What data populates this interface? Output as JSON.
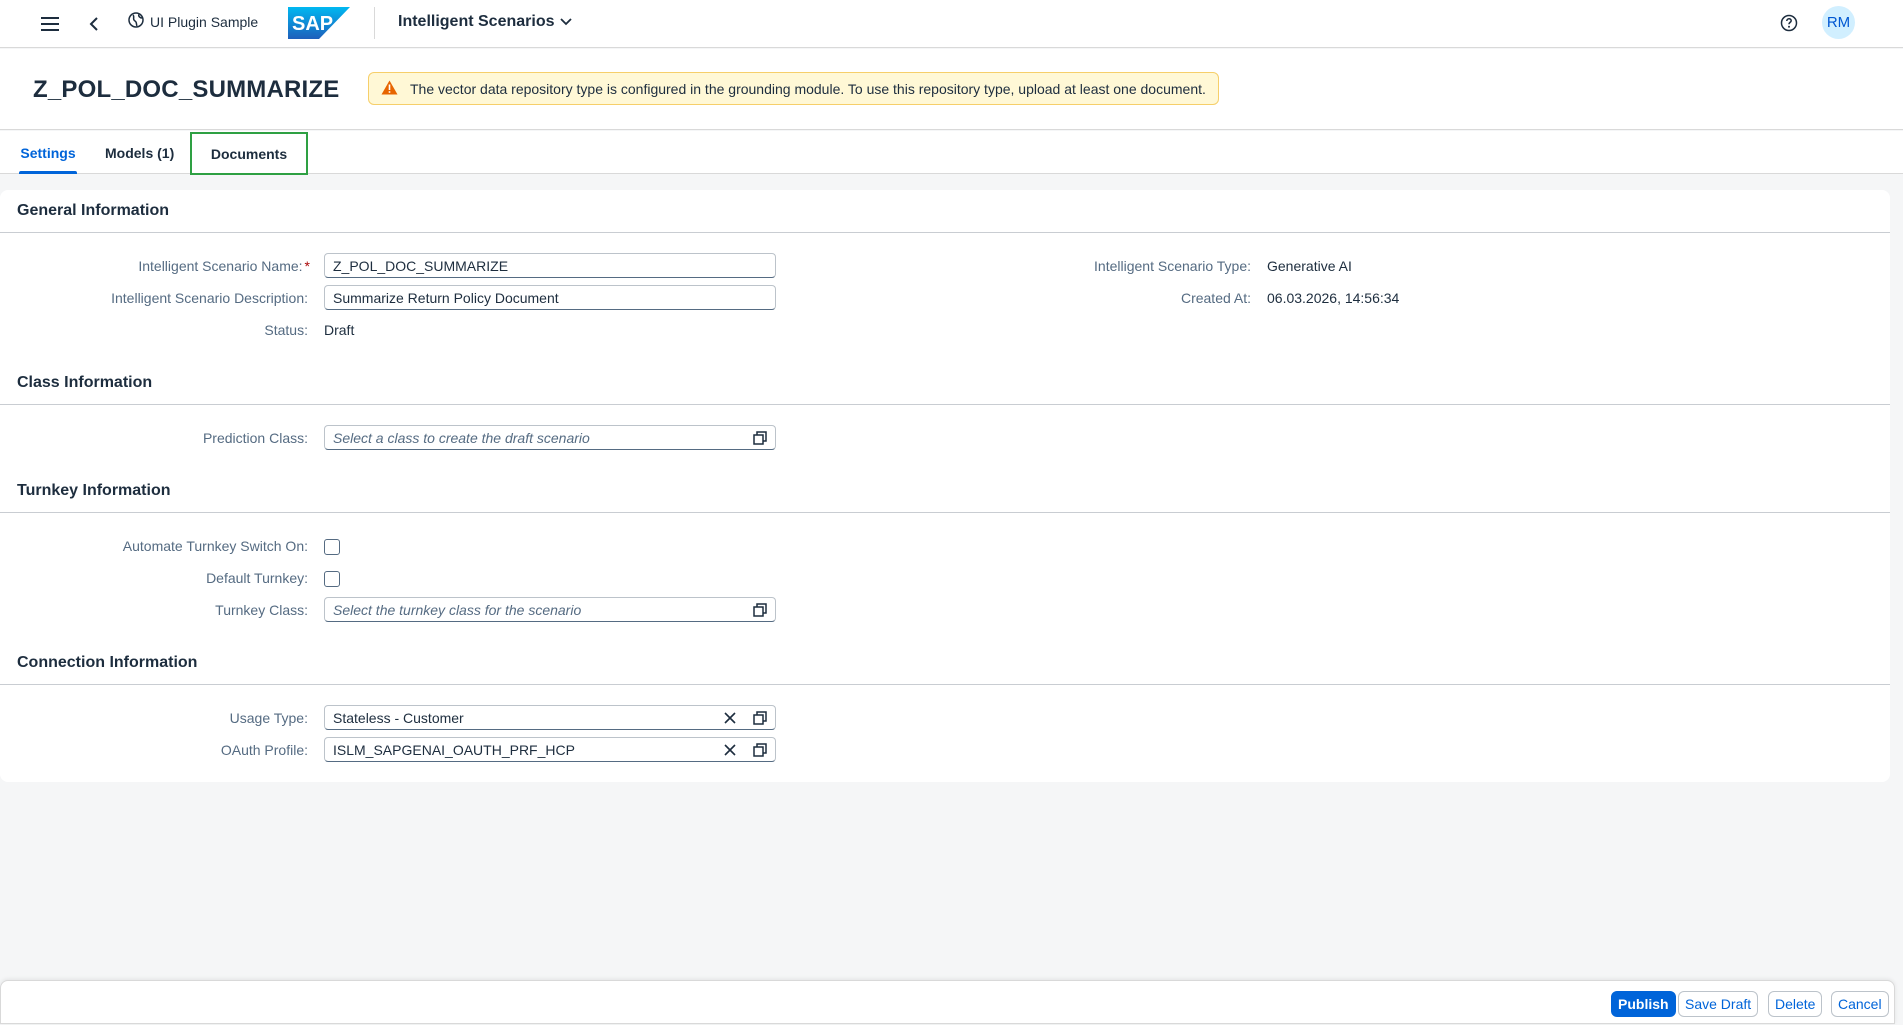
{
  "shell": {
    "plugin_label": "UI Plugin Sample",
    "logo_text": "SAP",
    "app_title": "Intelligent Scenarios",
    "avatar_initials": "RM"
  },
  "header": {
    "title": "Z_POL_DOC_SUMMARIZE",
    "warning": "The vector data repository type is configured in the grounding module. To use this repository type, upload at least one document."
  },
  "tabs": [
    {
      "label": "Settings",
      "active": true
    },
    {
      "label": "Models (1)",
      "active": false
    },
    {
      "label": "Documents",
      "active": false
    }
  ],
  "general": {
    "title": "General Information",
    "name_label": "Intelligent Scenario Name:",
    "name_required": "*",
    "name_value": "Z_POL_DOC_SUMMARIZE",
    "desc_label": "Intelligent Scenario Description:",
    "desc_value": "Summarize Return Policy Document",
    "status_label": "Status:",
    "status_value": "Draft",
    "type_label": "Intelligent Scenario Type:",
    "type_value": "Generative AI",
    "created_label": "Created At:",
    "created_value": "06.03.2026, 14:56:34"
  },
  "class_info": {
    "title": "Class Information",
    "prediction_label": "Prediction Class:",
    "prediction_placeholder": "Select a class to create the draft scenario"
  },
  "turnkey": {
    "title": "Turnkey Information",
    "automate_label": "Automate Turnkey Switch On:",
    "automate_checked": false,
    "default_label": "Default Turnkey:",
    "default_checked": false,
    "class_label": "Turnkey Class:",
    "class_placeholder": "Select the turnkey class for the scenario"
  },
  "connection": {
    "title": "Connection Information",
    "usage_label": "Usage Type:",
    "usage_value": "Stateless - Customer",
    "oauth_label": "OAuth Profile:",
    "oauth_value": "ISLM_SAPGENAI_OAUTH_PRF_HCP"
  },
  "footer": {
    "publish": "Publish",
    "save_draft": "Save Draft",
    "delete": "Delete",
    "cancel": "Cancel"
  },
  "colors": {
    "accent": "#0064d9",
    "warning_bg": "#fff8d6",
    "warning_icon": "#e76500",
    "highlight_box": "#2ea043"
  },
  "icons": [
    "menu-icon",
    "back-icon",
    "globe-icon",
    "sap-logo",
    "chevron-down-icon",
    "help-icon",
    "warning-icon",
    "value-help-icon",
    "clear-icon"
  ]
}
